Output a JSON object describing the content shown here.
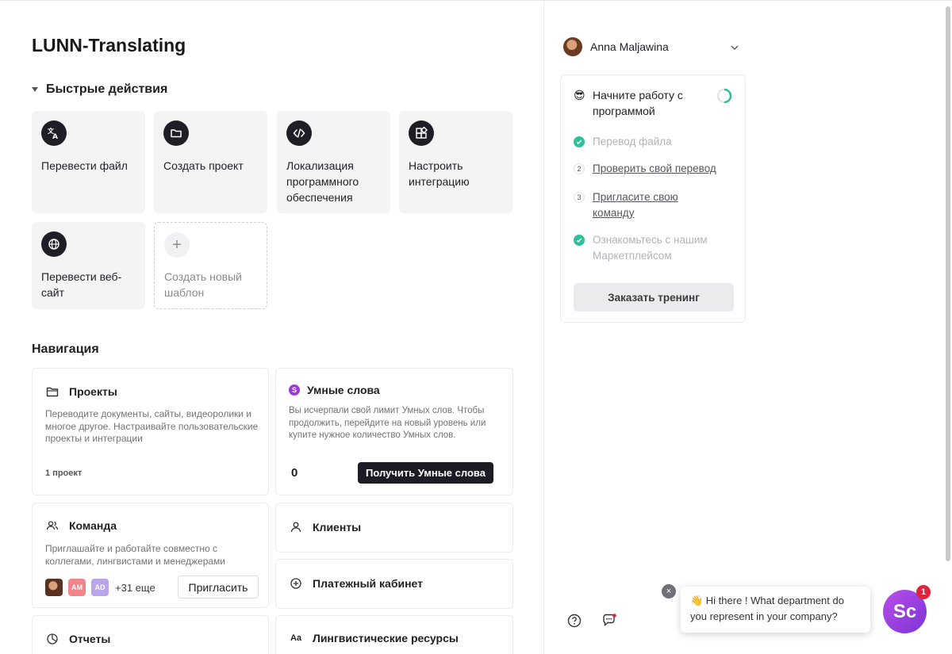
{
  "app": {
    "title": "LUNN-Translating"
  },
  "quick_actions": {
    "title": "Быстрые действия",
    "items": [
      {
        "label": "Перевести файл",
        "icon": "translate-icon"
      },
      {
        "label": "Создать проект",
        "icon": "folder-icon"
      },
      {
        "label": "Локализация программного обеспечения",
        "icon": "code-icon"
      },
      {
        "label": "Настроить интеграцию",
        "icon": "apps-icon"
      },
      {
        "label": "Перевести веб-сайт",
        "icon": "globe-icon"
      },
      {
        "label": "Создать новый шаблон",
        "icon": "plus-icon"
      }
    ]
  },
  "navigation": {
    "title": "Навигация",
    "projects": {
      "title": "Проекты",
      "desc": "Переводите документы, сайты, видеоролики и многое другое. Настраивайте пользовательские проекты и интеграции",
      "count": "1 проект"
    },
    "smart_words": {
      "title": "Умные слова",
      "badge": "S",
      "desc": "Вы исчерпали свой лимит Умных слов. Чтобы продолжить, перейдите на новый уровень или купите нужное количество Умных слов.",
      "count": "0",
      "button": "Получить Умные слова"
    },
    "team": {
      "title": "Команда",
      "desc": "Приглашайте и работайте совместно с коллегами, лингвистами и менеджерами",
      "avatars": [
        "AM",
        "AD"
      ],
      "more": "+31 еще",
      "invite": "Пригласить"
    },
    "clients": {
      "title": "Клиенты"
    },
    "billing": {
      "title": "Платежный кабинет"
    },
    "reports": {
      "title": "Отчеты"
    },
    "linguistic": {
      "title": "Лингвистические ресурсы",
      "icon_text": "Aa"
    }
  },
  "user": {
    "name": "Anna Maljawina"
  },
  "onboarding": {
    "emoji": "😎",
    "title": "Начните работу с программой",
    "progress": 0.5,
    "steps": [
      {
        "text": "Перевод файла",
        "done": true
      },
      {
        "num": "2",
        "text": "Проверить свой перевод",
        "done": false
      },
      {
        "num": "3",
        "text": "Пригласите свою команду",
        "done": false
      },
      {
        "text": "Ознакомьтесь с нашим Маркетплейсом",
        "done": true
      }
    ],
    "button": "Заказать тренинг"
  },
  "chat": {
    "close": "×",
    "message": "👋 Hi there ! What department do you represent in your company?",
    "logo": "Sc",
    "badge": "1"
  },
  "colors": {
    "accent_dark": "#1d1b26",
    "check_green": "#2fbf9a",
    "smart_purple": "#9b3ad6",
    "chat_purple": "#a444e0"
  }
}
